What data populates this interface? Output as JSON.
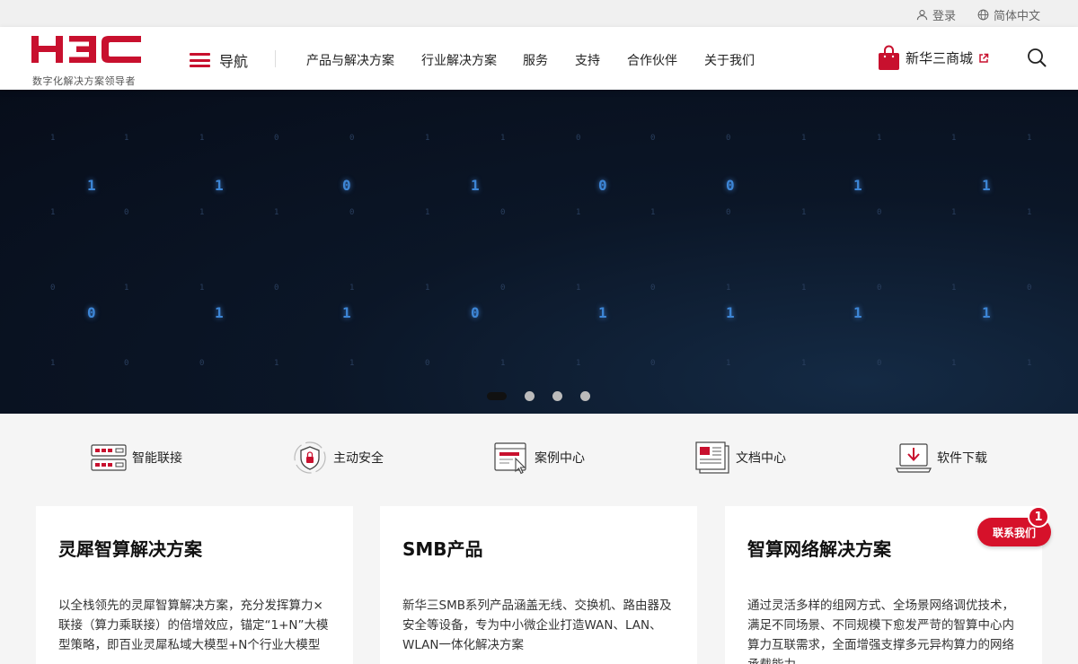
{
  "topbar": {
    "login": "登录",
    "language": "简体中文"
  },
  "header": {
    "logo_text": "H3C",
    "logo_sub": "数字化解决方案领导者",
    "menu_label": "导航",
    "nav": [
      "产品与解决方案",
      "行业解决方案",
      "服务",
      "支持",
      "合作伙伴",
      "关于我们"
    ],
    "shop_label": "新华三商城"
  },
  "hero": {
    "row1": [
      "1",
      "1",
      "0",
      "1",
      "0",
      "0",
      "1",
      "1"
    ],
    "row2": [
      "0",
      "1",
      "1",
      "0",
      "1",
      "1",
      "1",
      "1"
    ],
    "slides_total": 4,
    "slide_active": 1
  },
  "quick_links": [
    "智能联接",
    "主动安全",
    "案例中心",
    "文档中心",
    "软件下载"
  ],
  "cards": [
    {
      "title": "灵犀智算解决方案",
      "desc": "以全栈领先的灵犀智算解决方案，充分发挥算力×联接（算力乘联接）的倍增效应，锚定“1+N”大模型策略，即百业灵犀私域大模型+N个行业大模型"
    },
    {
      "title": "SMB产品",
      "desc": "新华三SMB系列产品涵盖无线、交换机、路由器及安全等设备，专为中小微企业打造WAN、LAN、WLAN一体化解决方案"
    },
    {
      "title": "智算网络解决方案",
      "desc": "通过灵活多样的组网方式、全场景网络调优技术，满足不同场景、不同规模下愈发严苛的智算中心内算力互联需求，全面增强支撑多元异构算力的网络承载能力"
    }
  ],
  "contact": {
    "label": "联系我们",
    "badge": "1"
  },
  "colors": {
    "brand_red": "#c8102e",
    "hero_bg": "#070d1a",
    "digit_blue": "#3d86d6"
  }
}
